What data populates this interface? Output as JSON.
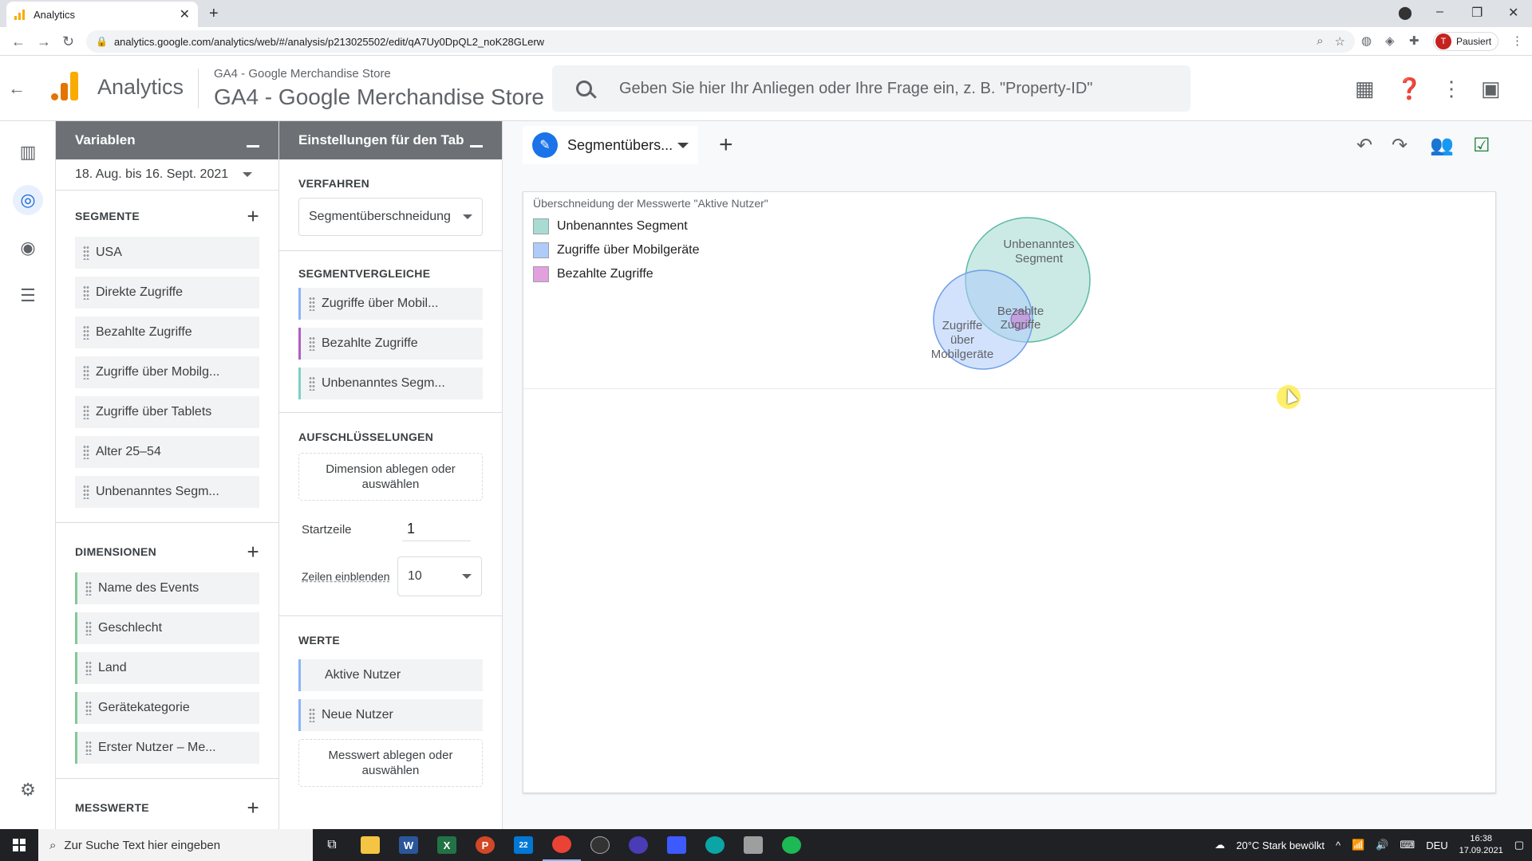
{
  "browser": {
    "tab_title": "Analytics",
    "url": "analytics.google.com/analytics/web/#/analysis/p213025502/edit/qA7Uy0DpQL2_noK28GLerw",
    "profile_label": "Pausiert",
    "profile_initial": "T"
  },
  "header": {
    "app_name": "Analytics",
    "property_small": "GA4 - Google Merchandise Store",
    "property_large": "GA4 - Google Merchandise Store",
    "search_placeholder": "Geben Sie hier Ihr Anliegen oder Ihre Frage ein, z. B. \"Property-ID\""
  },
  "variables_panel": {
    "title": "Variablen",
    "date_range": "18. Aug. bis 16. Sept. 2021",
    "segments_title": "SEGMENTE",
    "segments": [
      "USA",
      "Direkte Zugriffe",
      "Bezahlte Zugriffe",
      "Zugriffe über Mobilg...",
      "Zugriffe über Tablets",
      "Alter 25–54",
      "Unbenanntes Segm..."
    ],
    "dimensions_title": "DIMENSIONEN",
    "dimensions": [
      "Name des Events",
      "Geschlecht",
      "Land",
      "Gerätekategorie",
      "Erster Nutzer – Me..."
    ],
    "metrics_title": "MESSWERTE"
  },
  "settings_panel": {
    "title": "Einstellungen für den Tab",
    "technique_title": "VERFAHREN",
    "technique_value": "Segmentüberschneidung",
    "comparisons_title": "SEGMENTVERGLEICHE",
    "comparisons": [
      "Zugriffe über Mobil...",
      "Bezahlte Zugriffe",
      "Unbenanntes Segm..."
    ],
    "breakdowns_title": "AUFSCHLÜSSELUNGEN",
    "breakdowns_drop": "Dimension ablegen oder auswählen",
    "start_row_label": "Startzeile",
    "start_row_value": "1",
    "show_rows_label": "Zeilen einblenden",
    "show_rows_value": "10",
    "values_title": "WERTE",
    "values": [
      "Aktive Nutzer",
      "Neue Nutzer"
    ],
    "values_drop": "Messwert ablegen oder auswählen"
  },
  "canvas": {
    "tab_label": "Segmentübers...",
    "viz_title": "Überschneidung der Messwerte \"Aktive Nutzer\"",
    "legend": [
      {
        "label": "Unbenanntes Segment",
        "color": "#a8dcd3"
      },
      {
        "label": "Zugriffe über Mobilgeräte",
        "color": "#aecbfa"
      },
      {
        "label": "Bezahlte Zugriffe",
        "color": "#e3a0df"
      }
    ],
    "venn_labels": {
      "unnamed_1": "Unbenanntes",
      "unnamed_2": "Segment",
      "mobile_1": "Zugriffe",
      "mobile_2": "über",
      "mobile_3": "Mobilgeräte",
      "paid_1": "Bezahlte",
      "paid_2": "Zugriffe"
    }
  },
  "taskbar": {
    "search_placeholder": "Zur Suche Text hier eingeben",
    "mail_badge": "22",
    "weather": "20°C  Stark bewölkt",
    "language": "DEU",
    "time": "16:38",
    "date": "17.09.2021"
  }
}
